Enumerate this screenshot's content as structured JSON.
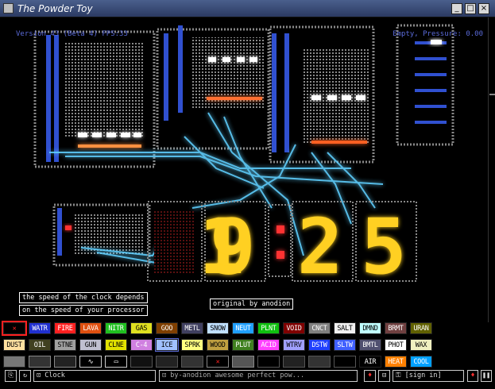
{
  "window": {
    "title": "The Powder Toy",
    "min_label": "_",
    "max_label": "□",
    "close_label": "×"
  },
  "hud": {
    "version": "Version 43 (Beta 4) FPS:33",
    "pressure": "Empty, Pressure: 0.00"
  },
  "notes": {
    "speed1": "the speed of the clock depends",
    "speed2": "on the speed of your processor",
    "credit": "original by anodion"
  },
  "clock": {
    "digits": "1925"
  },
  "elements": {
    "row1": [
      {
        "label": "✕",
        "bg": "#000000",
        "fg": "#ff2020"
      },
      {
        "label": "WATR",
        "bg": "#2030d0",
        "fg": "#ffffff"
      },
      {
        "label": "FIRE",
        "bg": "#ff2020",
        "fg": "#ffffff"
      },
      {
        "label": "LAVA",
        "bg": "#e05010",
        "fg": "#ffffff"
      },
      {
        "label": "NITR",
        "bg": "#20c020",
        "fg": "#ffffff"
      },
      {
        "label": "GAS",
        "bg": "#e0e020",
        "fg": "#000000"
      },
      {
        "label": "GOO",
        "bg": "#804000",
        "fg": "#ffffff"
      },
      {
        "label": "METL",
        "bg": "#404060",
        "fg": "#ffffff"
      },
      {
        "label": "SNOW",
        "bg": "#c0e0ff",
        "fg": "#000000"
      },
      {
        "label": "NEUT",
        "bg": "#20a0ff",
        "fg": "#ffffff"
      },
      {
        "label": "PLNT",
        "bg": "#10c010",
        "fg": "#ffffff"
      },
      {
        "label": "VOID",
        "bg": "#800000",
        "fg": "#ffffff"
      },
      {
        "label": "CNCT",
        "bg": "#808080",
        "fg": "#ffffff"
      },
      {
        "label": "SALT",
        "bg": "#f0f0f0",
        "fg": "#000000"
      },
      {
        "label": "DMND",
        "bg": "#c0ffff",
        "fg": "#000000"
      },
      {
        "label": "BRMT",
        "bg": "#704040",
        "fg": "#ffffff"
      },
      {
        "label": "URAN",
        "bg": "#606000",
        "fg": "#ffffff"
      }
    ],
    "row2": [
      {
        "label": "DUST",
        "bg": "#ffe0a0",
        "fg": "#000000"
      },
      {
        "label": "OIL",
        "bg": "#404020",
        "fg": "#ffffff"
      },
      {
        "label": "STNE",
        "bg": "#a0a0a0",
        "fg": "#000000"
      },
      {
        "label": "GUN",
        "bg": "#c0c0d0",
        "fg": "#000000"
      },
      {
        "label": "CLNE",
        "bg": "#e0e000",
        "fg": "#000000"
      },
      {
        "label": "C-4",
        "bg": "#d080e0",
        "fg": "#ffffff"
      },
      {
        "label": "ICE",
        "bg": "#a0c0ff",
        "fg": "#000000"
      },
      {
        "label": "SPRK",
        "bg": "#ffff80",
        "fg": "#000000"
      },
      {
        "label": "WOOD",
        "bg": "#c0a040",
        "fg": "#000000"
      },
      {
        "label": "PLUT",
        "bg": "#408020",
        "fg": "#ffffff"
      },
      {
        "label": "ACID",
        "bg": "#ff40ff",
        "fg": "#ffffff"
      },
      {
        "label": "WTRV",
        "bg": "#a0a0ff",
        "fg": "#000000"
      },
      {
        "label": "DSTW",
        "bg": "#2040ff",
        "fg": "#ffffff"
      },
      {
        "label": "SLTW",
        "bg": "#4060ff",
        "fg": "#ffffff"
      },
      {
        "label": "BMTL",
        "bg": "#505070",
        "fg": "#ffffff"
      },
      {
        "label": "PHOT",
        "bg": "#ffffff",
        "fg": "#000000"
      },
      {
        "label": "WAX",
        "bg": "#f0f0c0",
        "fg": "#000000"
      }
    ],
    "row3_right": [
      {
        "label": "AIR",
        "bg": "#000000",
        "fg": "#ffffff"
      },
      {
        "label": "HEAT",
        "bg": "#ff8000",
        "fg": "#ffffff"
      },
      {
        "label": "COOL",
        "bg": "#00a0ff",
        "fg": "#ffffff"
      }
    ]
  },
  "bottombar": {
    "save_name": "Clock",
    "save_desc": "by-anodion awesome perfect pow...",
    "signin": "[sign in]"
  }
}
